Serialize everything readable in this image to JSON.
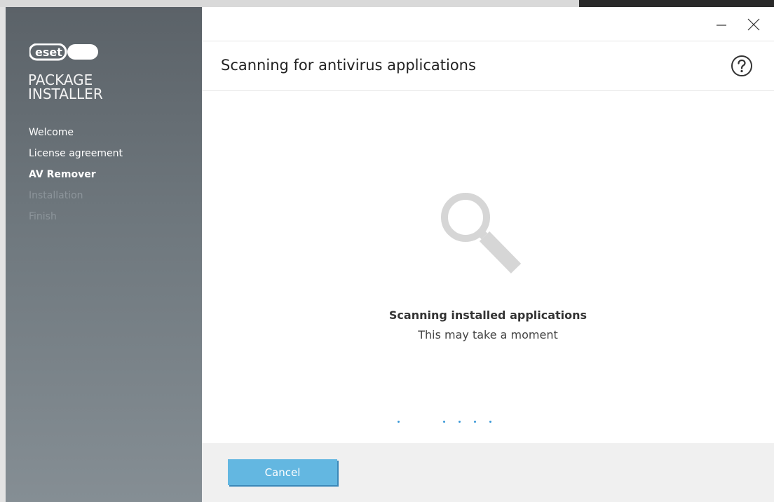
{
  "brand": {
    "logo_text": "eset",
    "product_line1": "PACKAGE",
    "product_line2": "INSTALLER"
  },
  "sidebar": {
    "items": [
      {
        "label": "Welcome",
        "state": "done"
      },
      {
        "label": "License agreement",
        "state": "done"
      },
      {
        "label": "AV Remover",
        "state": "active"
      },
      {
        "label": "Installation",
        "state": "pending"
      },
      {
        "label": "Finish",
        "state": "pending"
      }
    ]
  },
  "header": {
    "title": "Scanning for antivirus applications",
    "help_icon": "question-circle-icon"
  },
  "window_controls": {
    "minimize_icon": "minimize-icon",
    "close_icon": "close-icon"
  },
  "content": {
    "illustration_icon": "magnifier-icon",
    "status_title": "Scanning installed applications",
    "status_subtitle": "This may take a moment"
  },
  "footer": {
    "cancel_label": "Cancel"
  },
  "colors": {
    "accent": "#63b7e1",
    "progress_dot": "#3d9ad8",
    "sidebar_top": "#5b6268",
    "sidebar_bottom": "#858e94"
  }
}
